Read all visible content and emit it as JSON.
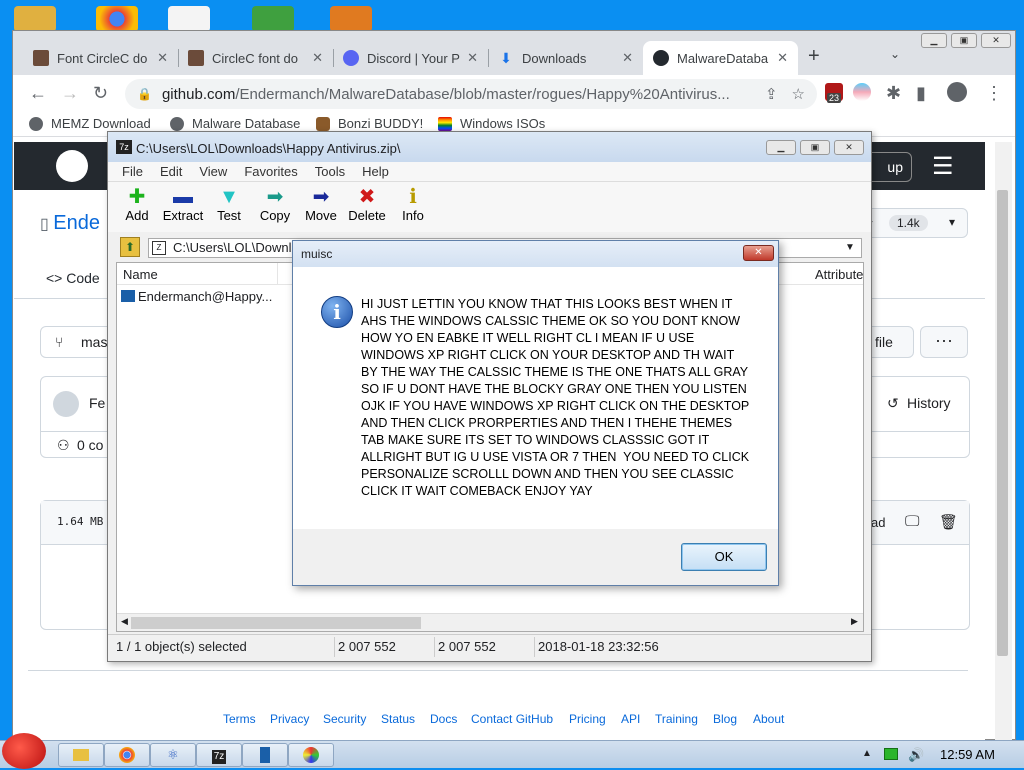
{
  "browser": {
    "tabs": [
      {
        "title": "Font CircleC do",
        "color": "#6b4b3a"
      },
      {
        "title": "CircleC font do",
        "color": "#6b4b3a"
      },
      {
        "title": "Discord | Your P",
        "color": "#5865f2"
      },
      {
        "title": "Downloads",
        "color": "#1a73e8"
      },
      {
        "title": "MalwareDataba",
        "color": "#24292f"
      }
    ],
    "url_host": "github.com",
    "url_path": "/Endermanch/MalwareDatabase/blob/master/rogues/Happy%20Antivirus...",
    "extension_badge": "23",
    "bookmarks": [
      "MEMZ Download",
      "Malware Database",
      "Bonzi BUDDY!",
      "Windows ISOs"
    ]
  },
  "github": {
    "repo_name_partial": "Ende",
    "tab_code": "Code",
    "branch_partial": "mas",
    "star_label_partial": "ar",
    "star_count": "1.4k",
    "author_partial": "Fe",
    "history_label": "History",
    "contributors_partial": "0 co",
    "file_size": "1.64 MB",
    "add_file_partial": "file",
    "download_partial": "ad",
    "signup_partial": "up",
    "footer_links": [
      "Terms",
      "Privacy",
      "Security",
      "Status",
      "Docs",
      "Contact GitHub",
      "Pricing",
      "API",
      "Training",
      "Blog",
      "About"
    ]
  },
  "sevenzip": {
    "title": "C:\\Users\\LOL\\Downloads\\Happy Antivirus.zip\\",
    "menu": [
      "File",
      "Edit",
      "View",
      "Favorites",
      "Tools",
      "Help"
    ],
    "tools": [
      {
        "label": "Add",
        "icon": "plus-icon",
        "glyph": "✚",
        "color": "#1db31d"
      },
      {
        "label": "Extract",
        "icon": "minus-icon",
        "glyph": "▬",
        "color": "#1a3aa8"
      },
      {
        "label": "Test",
        "icon": "check-icon",
        "glyph": "▼",
        "color": "#22c4c4"
      },
      {
        "label": "Copy",
        "icon": "copy-arrow-icon",
        "glyph": "➡",
        "color": "#1a9a8a"
      },
      {
        "label": "Move",
        "icon": "move-arrow-icon",
        "glyph": "➡",
        "color": "#1a2a9a"
      },
      {
        "label": "Delete",
        "icon": "delete-x-icon",
        "glyph": "✖",
        "color": "#d01818"
      },
      {
        "label": "Info",
        "icon": "info-icon",
        "glyph": "ℹ",
        "color": "#b89b00"
      }
    ],
    "path": "C:\\Users\\LOL\\Downlo",
    "column_name": "Name",
    "column_attributes": "Attribute",
    "file_name": "Endermanch@Happy...",
    "status": {
      "selected": "1 / 1 object(s) selected",
      "size": "2 007 552",
      "packed": "2 007 552",
      "modified": "2018-01-18 23:32:56"
    }
  },
  "dialog": {
    "title": "muisc",
    "message": "HI JUST LETTIN YOU KNOW THAT THIS LOOKS BEST WHEN IT\nAHS THE WINDOWS CALSSIC THEME OK SO YOU DONT KNOW\nHOW YO EN EABKE IT WELL RIGHT CL I MEAN IF U USE\nWINDOWS XP RIGHT CLICK ON YOUR DESKTOP AND TH WAIT\nBY THE WAY THE CALSSIC THEME IS THE ONE THATS ALL GRAY\nSO IF U DONT HAVE THE BLOCKY GRAY ONE THEN YOU LISTEN\nOJK IF YOU HAVE WINDOWS XP RIGHT CLICK ON THE DESKTOP\nAND THEN CLICK PRORPERTIES AND THEN I THEHE THEMES\nTAB MAKE SURE ITS SET TO WINDOWS CLASSSIC GOT IT\nALLRIGHT BUT IG U USE VISTA OR 7 THEN  YOU NEED TO CLICK\nPERSONALIZE SCROLLL DOWN AND THEN YOU SEE CLASSIC\nCLICK IT WAIT COMEBACK ENJOY YAY",
    "ok_label": "OK"
  },
  "taskbar": {
    "clock": "12:59 AM"
  }
}
